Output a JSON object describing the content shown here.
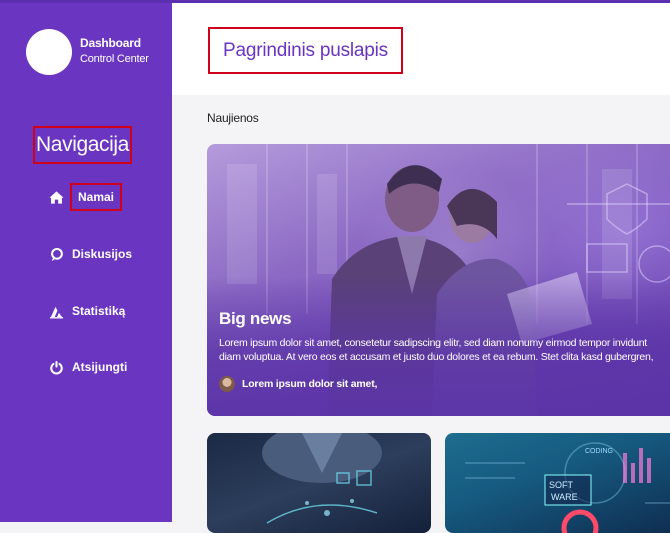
{
  "brand": {
    "title": "Dashboard",
    "subtitle": "Control Center"
  },
  "sidebar": {
    "heading": "Navigacija",
    "items": [
      {
        "label": "Namai",
        "icon": "home-icon"
      },
      {
        "label": "Diskusijos",
        "icon": "chat-bubble-icon"
      },
      {
        "label": "Statistiką",
        "icon": "chart-icon"
      },
      {
        "label": "Atsijungti",
        "icon": "power-icon"
      }
    ]
  },
  "main": {
    "page_title": "Pagrindinis puslapis",
    "section_label": "Naujienos",
    "hero": {
      "title": "Big news",
      "body_line1": "Lorem ipsum dolor sit amet, consetetur sadipscing elitr, sed diam nonumy eirmod tempor invidunt",
      "body_line2": "diam voluptua. At vero eos et accusam et justo duo dolores et ea rebum. Stet clita kasd gubergren,",
      "author": "Lorem ipsum dolor sit amet,"
    },
    "cards": [
      {
        "image": "technology-hand-image"
      },
      {
        "image": "software-coding-image",
        "visible_text": [
          "CODING",
          "SOFT WARE"
        ]
      }
    ]
  },
  "colors": {
    "sidebar": "#6a35c0",
    "accent": "#6a35c0",
    "highlight_border": "#d0021b",
    "background": "#f4f4f6"
  }
}
